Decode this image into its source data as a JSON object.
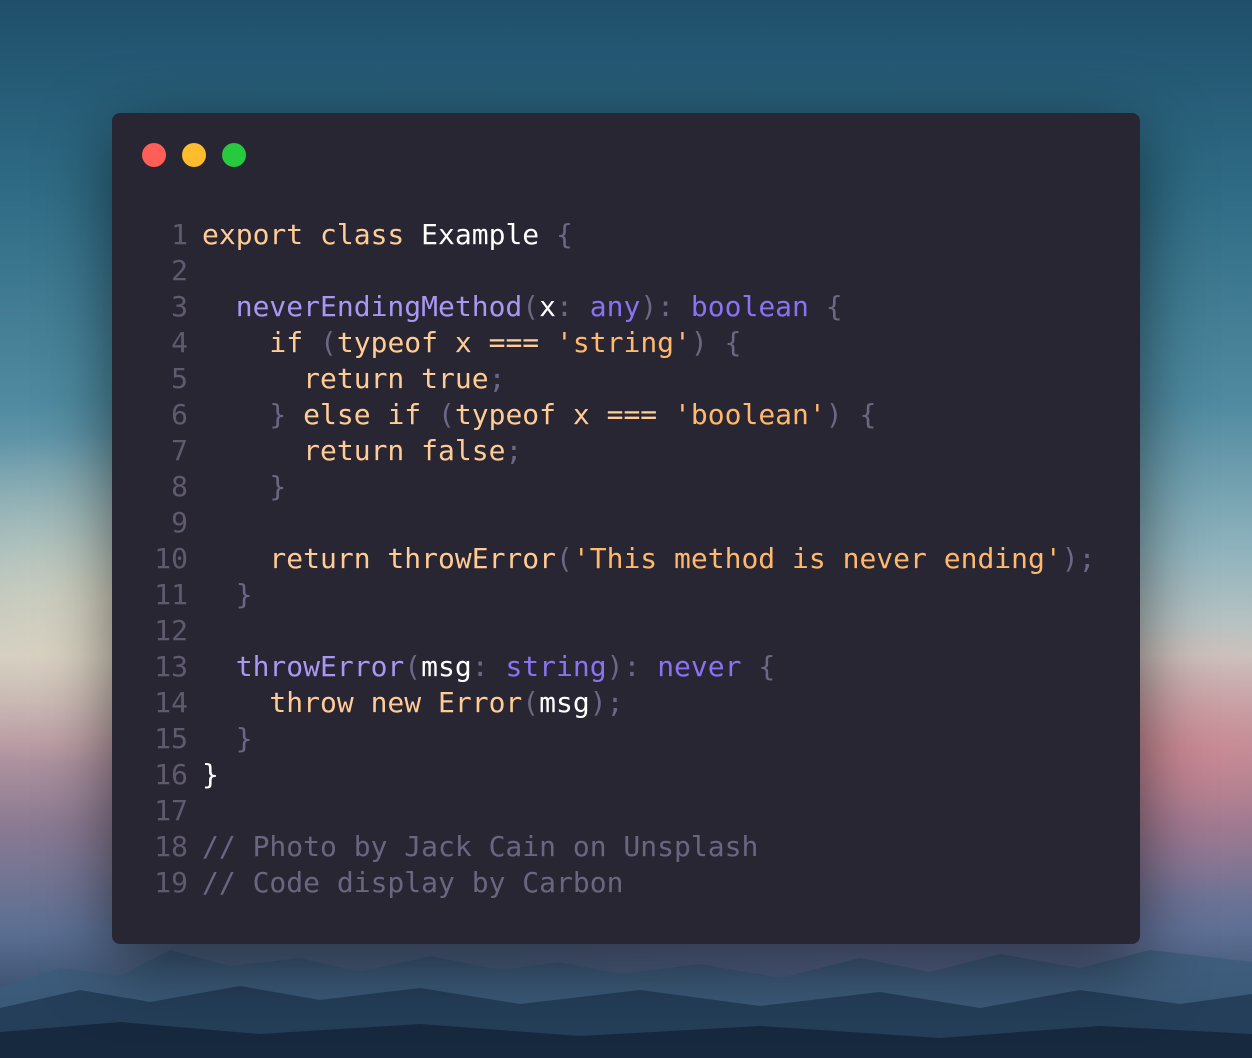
{
  "window": {
    "controls": [
      "close",
      "minimize",
      "maximize"
    ],
    "colors": {
      "background": "#292634",
      "close": "#ff5f56",
      "minimize": "#ffbd2e",
      "maximize": "#27c93f"
    }
  },
  "code": {
    "lines": [
      {
        "n": "1",
        "t": [
          {
            "c": "kw",
            "v": "export class "
          },
          {
            "c": "id",
            "v": "Example"
          },
          {
            "c": "pn",
            "v": " {"
          }
        ]
      },
      {
        "n": "2",
        "t": []
      },
      {
        "n": "3",
        "t": [
          {
            "c": "fn",
            "v": "  neverEndingMethod"
          },
          {
            "c": "pn",
            "v": "("
          },
          {
            "c": "id",
            "v": "x"
          },
          {
            "c": "pn",
            "v": ": "
          },
          {
            "c": "ty",
            "v": "any"
          },
          {
            "c": "pn",
            "v": "): "
          },
          {
            "c": "ty",
            "v": "boolean"
          },
          {
            "c": "pn",
            "v": " {"
          }
        ]
      },
      {
        "n": "4",
        "t": [
          {
            "c": "kw",
            "v": "    if "
          },
          {
            "c": "pn",
            "v": "("
          },
          {
            "c": "kw",
            "v": "typeof x === "
          },
          {
            "c": "st",
            "v": "'string'"
          },
          {
            "c": "pn",
            "v": ") {"
          }
        ]
      },
      {
        "n": "5",
        "t": [
          {
            "c": "kw",
            "v": "      return true"
          },
          {
            "c": "pn",
            "v": ";"
          }
        ]
      },
      {
        "n": "6",
        "t": [
          {
            "c": "pn",
            "v": "    } "
          },
          {
            "c": "kw",
            "v": "else if "
          },
          {
            "c": "pn",
            "v": "("
          },
          {
            "c": "kw",
            "v": "typeof x === "
          },
          {
            "c": "st",
            "v": "'boolean'"
          },
          {
            "c": "pn",
            "v": ") {"
          }
        ]
      },
      {
        "n": "7",
        "t": [
          {
            "c": "kw",
            "v": "      return false"
          },
          {
            "c": "pn",
            "v": ";"
          }
        ]
      },
      {
        "n": "8",
        "t": [
          {
            "c": "pn",
            "v": "    }"
          }
        ]
      },
      {
        "n": "9",
        "t": []
      },
      {
        "n": "10",
        "t": [
          {
            "c": "kw",
            "v": "    return throwError"
          },
          {
            "c": "pn",
            "v": "("
          },
          {
            "c": "st",
            "v": "'This method is never ending'"
          },
          {
            "c": "pn",
            "v": ");"
          }
        ]
      },
      {
        "n": "11",
        "t": [
          {
            "c": "pn",
            "v": "  }"
          }
        ]
      },
      {
        "n": "12",
        "t": []
      },
      {
        "n": "13",
        "t": [
          {
            "c": "fn",
            "v": "  throwError"
          },
          {
            "c": "pn",
            "v": "("
          },
          {
            "c": "id",
            "v": "msg"
          },
          {
            "c": "pn",
            "v": ": "
          },
          {
            "c": "ty",
            "v": "string"
          },
          {
            "c": "pn",
            "v": "): "
          },
          {
            "c": "ty",
            "v": "never"
          },
          {
            "c": "pn",
            "v": " {"
          }
        ]
      },
      {
        "n": "14",
        "t": [
          {
            "c": "kw",
            "v": "    throw new Error"
          },
          {
            "c": "pn",
            "v": "("
          },
          {
            "c": "id",
            "v": "msg"
          },
          {
            "c": "pn",
            "v": ");"
          }
        ]
      },
      {
        "n": "15",
        "t": [
          {
            "c": "pn",
            "v": "  }"
          }
        ]
      },
      {
        "n": "16",
        "t": [
          {
            "c": "id",
            "v": "}"
          }
        ]
      },
      {
        "n": "17",
        "t": []
      },
      {
        "n": "18",
        "t": [
          {
            "c": "cm",
            "v": "// Photo by Jack Cain on Unsplash"
          }
        ]
      },
      {
        "n": "19",
        "t": [
          {
            "c": "cm",
            "v": "// Code display by Carbon"
          }
        ]
      }
    ]
  }
}
